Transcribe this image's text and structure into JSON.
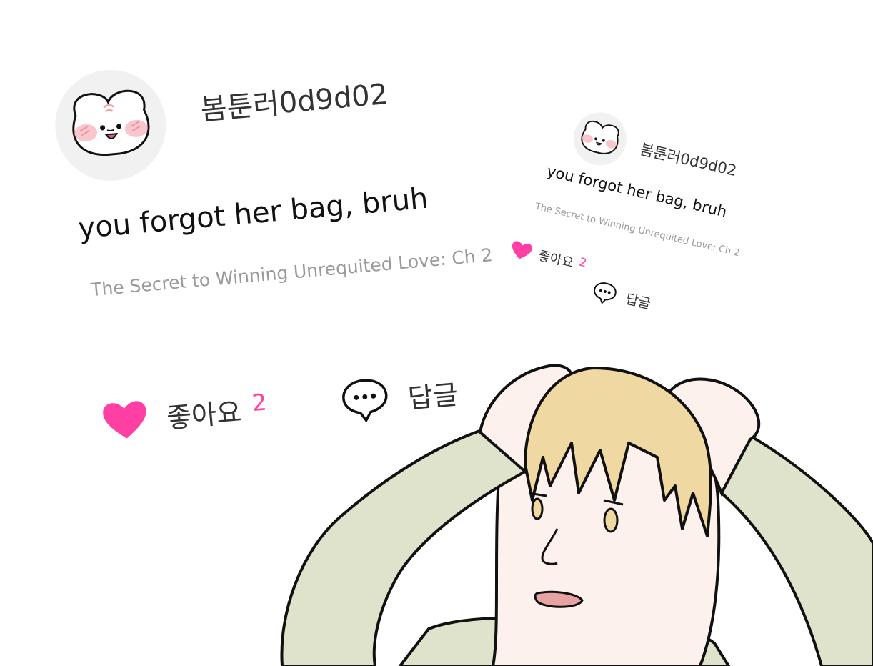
{
  "colors": {
    "heart": "#ff3fa4",
    "like_count": "#ff3fa4",
    "source_text": "#9a9a9a",
    "sleeve": "#dfe3cb",
    "hair": "#f0d8a2",
    "skin": "#fcf1ed"
  },
  "comment_large": {
    "username": "봄툰러0d9d02",
    "avatar_icon": "bunny-face-icon",
    "text": "you forgot her bag, bruh",
    "source": "The Secret to Winning Unrequited Love: Ch 2",
    "like_icon": "heart-icon",
    "like_label": "좋아요",
    "like_count": "2",
    "reply_icon": "speech-bubble-icon",
    "reply_label": "답글"
  },
  "comment_small": {
    "username": "봄툰러0d9d02",
    "avatar_icon": "bunny-face-icon",
    "text": "you forgot her bag, bruh",
    "source": "The Secret to Winning Unrequited Love: Ch 2",
    "like_icon": "heart-icon",
    "like_label": "좋아요",
    "like_count": "2",
    "reply_icon": "speech-bubble-icon",
    "reply_label": "답글"
  },
  "illustration": {
    "subject": "stressed-man-holding-head-illustration"
  }
}
